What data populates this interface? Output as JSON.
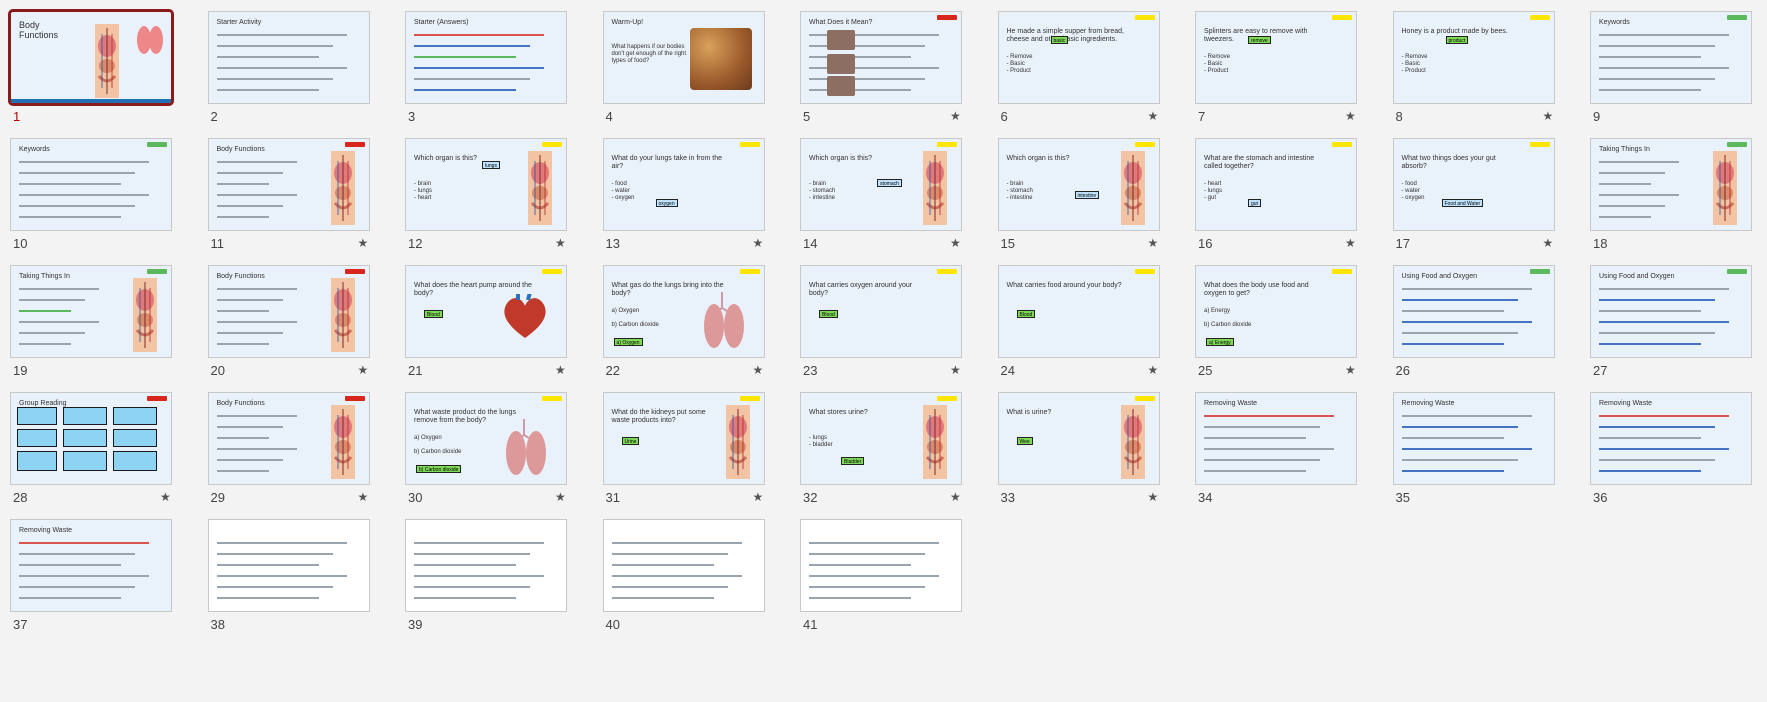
{
  "app": {
    "view": "Slide Sorter"
  },
  "slides": [
    {
      "n": "1",
      "star": false,
      "title": "Body\nFunctions",
      "selected": true
    },
    {
      "n": "2",
      "star": false,
      "title": "Starter Activity"
    },
    {
      "n": "3",
      "star": false,
      "title": "Starter (Answers)"
    },
    {
      "n": "4",
      "star": false,
      "title": "Warm-Up!",
      "body": "What happens if our bodies don't get enough of the right types of food?"
    },
    {
      "n": "5",
      "star": true,
      "title": "What Does it Mean?"
    },
    {
      "n": "6",
      "star": true,
      "title": "He made a simple supper from bread, cheese and other basic ingredients.",
      "options": "- Remove\n- Basic\n- Product",
      "answer": "basic"
    },
    {
      "n": "7",
      "star": true,
      "title": "Splinters are easy to remove with tweezers.",
      "options": "- Remove\n- Basic\n- Product",
      "answer": "remove"
    },
    {
      "n": "8",
      "star": true,
      "title": "Honey is a product made by bees.",
      "options": "- Remove\n- Basic\n- Product",
      "answer": "product"
    },
    {
      "n": "9",
      "star": false,
      "title": "Keywords"
    },
    {
      "n": "10",
      "star": false,
      "title": "Keywords"
    },
    {
      "n": "11",
      "star": true,
      "title": "Body Functions"
    },
    {
      "n": "12",
      "star": true,
      "title": "Which organ is this?",
      "options": "- brain\n- lungs\n- heart",
      "answer": "lungs"
    },
    {
      "n": "13",
      "star": true,
      "title": "What do your lungs take in from the air?",
      "options": "- food\n- water\n- oxygen",
      "answer": "oxygen"
    },
    {
      "n": "14",
      "star": true,
      "title": "Which organ is this?",
      "options": "- brain\n- stomach\n- intestine",
      "answer": "stomach"
    },
    {
      "n": "15",
      "star": true,
      "title": "Which organ is this?",
      "options": "- brain\n- stomach\n- intestine",
      "answer": "intestine"
    },
    {
      "n": "16",
      "star": true,
      "title": "What are the stomach and intestine called together?",
      "options": "- heart\n- lungs\n- gut",
      "answer": "gut"
    },
    {
      "n": "17",
      "star": true,
      "title": "What two things does your gut absorb?",
      "options": "- food\n- water\n- oxygen",
      "answer": "Food and Water"
    },
    {
      "n": "18",
      "star": false,
      "title": "Taking Things In"
    },
    {
      "n": "19",
      "star": false,
      "title": "Taking Things In"
    },
    {
      "n": "20",
      "star": true,
      "title": "Body Functions"
    },
    {
      "n": "21",
      "star": true,
      "title": "What does the heart pump around the body?",
      "answer": "Blood"
    },
    {
      "n": "22",
      "star": true,
      "title": "What gas do the lungs bring into the body?",
      "options": "a) Oxygen\n\nb) Carbon dioxide",
      "answer": "a) Oxygen"
    },
    {
      "n": "23",
      "star": true,
      "title": "What carries oxygen around your body?",
      "answer": "Blood"
    },
    {
      "n": "24",
      "star": true,
      "title": "What carries food around your body?",
      "answer": "Blood"
    },
    {
      "n": "25",
      "star": true,
      "title": "What does the body use food and oxygen to get?",
      "options": "a) Energy\n\nb) Carbon dioxide",
      "answer": "a) Energy"
    },
    {
      "n": "26",
      "star": false,
      "title": "Using Food and Oxygen"
    },
    {
      "n": "27",
      "star": false,
      "title": "Using Food and Oxygen"
    },
    {
      "n": "28",
      "star": true,
      "title": "Group Reading"
    },
    {
      "n": "29",
      "star": true,
      "title": "Body Functions"
    },
    {
      "n": "30",
      "star": true,
      "title": "What waste product do the lungs remove from the body?",
      "options": "a) Oxygen\n\nb) Carbon dioxide",
      "answer": "b) Carbon dioxide"
    },
    {
      "n": "31",
      "star": true,
      "title": "What do the kidneys put some waste products into?",
      "answer": "Urine"
    },
    {
      "n": "32",
      "star": true,
      "title": "What stores urine?",
      "options": "- lungs\n- bladder",
      "answer": "Bladder"
    },
    {
      "n": "33",
      "star": true,
      "title": "What is urine?",
      "answer": "Wee"
    },
    {
      "n": "34",
      "star": false,
      "title": "Removing Waste"
    },
    {
      "n": "35",
      "star": false,
      "title": "Removing Waste"
    },
    {
      "n": "36",
      "star": false,
      "title": "Removing Waste"
    },
    {
      "n": "37",
      "star": false,
      "title": "Removing Waste"
    },
    {
      "n": "38",
      "star": false,
      "title": ""
    },
    {
      "n": "39",
      "star": false,
      "title": ""
    },
    {
      "n": "40",
      "star": false,
      "title": ""
    },
    {
      "n": "41",
      "star": false,
      "title": ""
    }
  ],
  "star_glyph": "★",
  "colors": {
    "slide_bg": "#e9f1fa",
    "selected_border": "#8b1a1a",
    "answer_green": "#7ed957",
    "tag_yellow": "#ffe600",
    "tag_red": "#d9261c",
    "tag_green": "#5cb85c"
  }
}
